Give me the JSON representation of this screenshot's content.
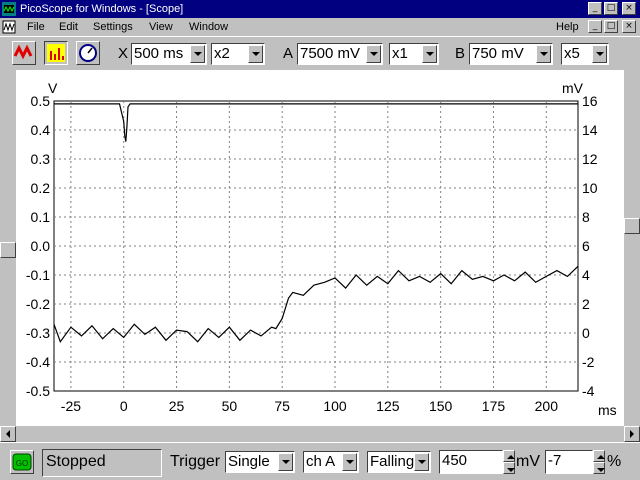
{
  "window": {
    "title": "PicoScope for Windows - [Scope]"
  },
  "menu": {
    "items": [
      "File",
      "Edit",
      "Settings",
      "View",
      "Window"
    ],
    "help": "Help"
  },
  "toolbar": {
    "x_label": "X",
    "timebase": "500 ms",
    "x_mult": "x2",
    "a_label": "A",
    "a_range": "7500 mV",
    "a_mult": "x1",
    "b_label": "B",
    "b_range": "750 mV",
    "b_mult": "x5"
  },
  "status": {
    "go_label": "GO",
    "state": "Stopped",
    "trigger_label": "Trigger",
    "trigger_mode": "Single",
    "trigger_channel": "ch A",
    "trigger_edge": "Falling",
    "trigger_level": "450",
    "level_unit": "mV",
    "delay": "-7",
    "delay_unit": "%"
  },
  "colors": {
    "title_bg": "#000080",
    "trace": "#000000",
    "grid": "#808080",
    "face": "#c0c0c0"
  },
  "chart_data": {
    "type": "line",
    "left_axis_unit": "V",
    "right_axis_unit": "mV",
    "x_axis_unit": "ms",
    "xlim": [
      -33,
      215
    ],
    "ylim_left": [
      -0.5,
      0.5
    ],
    "ylim_right": [
      -4,
      16
    ],
    "x_ticks": [
      "-25",
      "0",
      "25",
      "50",
      "75",
      "100",
      "125",
      "150",
      "175",
      "200"
    ],
    "left_ticks": [
      "0.5",
      "0.4",
      "0.3",
      "0.2",
      "0.1",
      "0.0",
      "-0.1",
      "-0.2",
      "-0.3",
      "-0.4",
      "-0.5"
    ],
    "right_ticks": [
      "16",
      "14",
      "12",
      "10",
      "8",
      "6",
      "4",
      "2",
      "0",
      "-2",
      "-4"
    ],
    "grid": true,
    "series": [
      {
        "axis": "left",
        "x": [
          -33,
          -2,
          -1,
          0,
          0.5,
          1,
          1.5,
          2,
          3,
          215
        ],
        "y": [
          0.49,
          0.49,
          0.46,
          0.43,
          0.38,
          0.36,
          0.41,
          0.48,
          0.49,
          0.49
        ]
      },
      {
        "axis": "right",
        "x": [
          -33,
          -30,
          -25,
          -20,
          -15,
          -10,
          -5,
          0,
          5,
          10,
          15,
          20,
          25,
          30,
          35,
          40,
          45,
          50,
          55,
          60,
          65,
          70,
          72,
          75,
          78,
          80,
          85,
          90,
          95,
          100,
          105,
          110,
          115,
          120,
          125,
          130,
          135,
          140,
          145,
          150,
          155,
          160,
          165,
          170,
          175,
          180,
          185,
          190,
          195,
          200,
          205,
          210,
          215
        ],
        "y": [
          0.6,
          -0.6,
          0.4,
          -0.2,
          0.5,
          -0.4,
          0.3,
          -0.3,
          0.6,
          -0.1,
          0.4,
          -0.5,
          0.2,
          0.1,
          -0.6,
          0.3,
          -0.3,
          0.4,
          -0.5,
          0.2,
          -0.2,
          0.4,
          0.3,
          1.0,
          2.4,
          2.8,
          2.6,
          3.3,
          3.5,
          3.8,
          3.1,
          4.0,
          3.3,
          3.9,
          3.4,
          4.3,
          3.6,
          3.9,
          3.5,
          4.1,
          3.4,
          4.3,
          3.7,
          3.9,
          3.6,
          4.0,
          3.6,
          4.2,
          3.5,
          3.9,
          4.3,
          3.9,
          4.6
        ]
      }
    ]
  }
}
